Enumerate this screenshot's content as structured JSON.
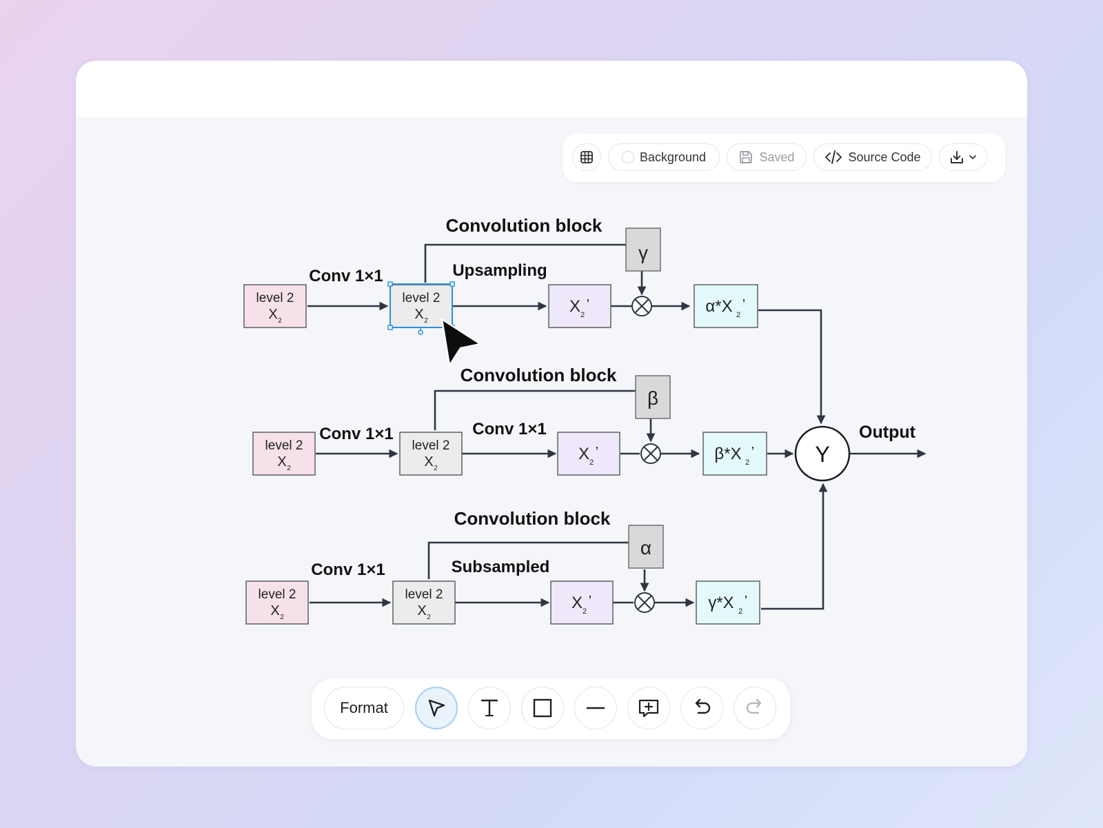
{
  "toolbar_top": {
    "grid_icon": "grid-icon",
    "background_label": "Background",
    "saved_label": "Saved",
    "source_code_label": "Source Code",
    "export_icon": "download-icon"
  },
  "toolbar_bottom": {
    "format_label": "Format",
    "tools": [
      "select-tool",
      "text-tool",
      "rectangle-tool",
      "line-tool",
      "comment-tool",
      "undo",
      "redo"
    ]
  },
  "diagram": {
    "rows": [
      {
        "conv_block_label": "Convolution block",
        "conv_label": "Conv 1×1",
        "op_label": "Upsampling",
        "weight": "γ",
        "input_line1": "level 2",
        "input_line2": "X",
        "input_sub": "2",
        "mid_line1": "level 2",
        "mid_line2": "X",
        "mid_sub": "2",
        "feature": "X",
        "feature_sub": "2",
        "feature_prime": "’",
        "result_prefix": "α*X",
        "result_sub": "2",
        "result_prime": "’"
      },
      {
        "conv_block_label": "Convolution block",
        "conv_label": "Conv 1×1",
        "op_label": "Conv 1×1",
        "weight": "β",
        "input_line1": "level 2",
        "input_line2": "X",
        "input_sub": "2",
        "mid_line1": "level 2",
        "mid_line2": "X",
        "mid_sub": "2",
        "feature": "X",
        "feature_sub": "2",
        "feature_prime": "’",
        "result_prefix": "β*X",
        "result_sub": "2",
        "result_prime": "’"
      },
      {
        "conv_block_label": "Convolution block",
        "conv_label": "Conv 1×1",
        "op_label": "Subsampled",
        "weight": "α",
        "input_line1": "level 2",
        "input_line2": "X",
        "input_sub": "2",
        "mid_line1": "level 2",
        "mid_line2": "X",
        "mid_sub": "2",
        "feature": "X",
        "feature_sub": "2",
        "feature_prime": "’",
        "result_prefix": "γ*X",
        "result_sub": "2",
        "result_prime": "’"
      }
    ],
    "sum_node": "Y",
    "output_label": "Output",
    "colors": {
      "input_fill": "#f6e1ea",
      "mid_fill": "#ececec",
      "feature_fill": "#efe8fb",
      "result_fill": "#e3f9fb",
      "weight_fill": "#d9d9d9",
      "selection": "#2b8fd9",
      "stroke": "#2f3542"
    }
  }
}
